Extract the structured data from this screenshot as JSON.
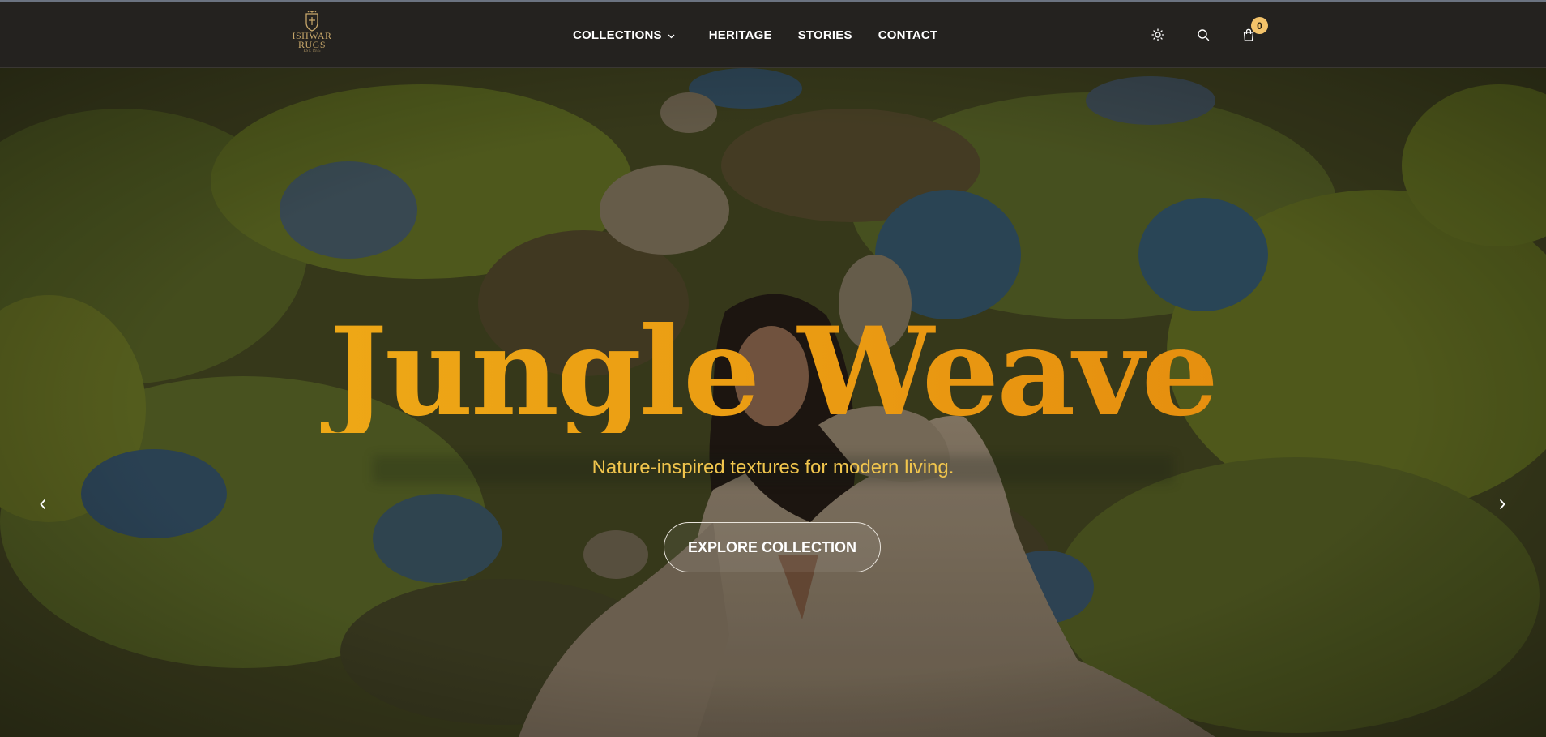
{
  "brand": {
    "logo_line1": "ISHWAR",
    "logo_line2": "RUGS",
    "logo_sub": "EST. 1935"
  },
  "nav": {
    "items": [
      {
        "label": "COLLECTIONS",
        "icon": "chevron-down-icon"
      },
      {
        "label": "HERITAGE"
      },
      {
        "label": "STORIES"
      },
      {
        "label": "CONTACT"
      }
    ]
  },
  "header_icons": {
    "theme": "sun-icon",
    "search": "search-icon",
    "cart": "shopping-bag-icon",
    "cart_count": "0"
  },
  "hero": {
    "title": "Jungle Weave",
    "subtitle": "Nature-inspired textures for modern living.",
    "cta_label": "EXPLORE COLLECTION",
    "prev_icon": "chevron-left-icon",
    "next_icon": "chevron-right-icon"
  },
  "colors": {
    "header_bg": "#24221f",
    "title_gold": "#f0b019",
    "subtitle_gold": "#f1c54d",
    "badge": "#f3c36a"
  }
}
